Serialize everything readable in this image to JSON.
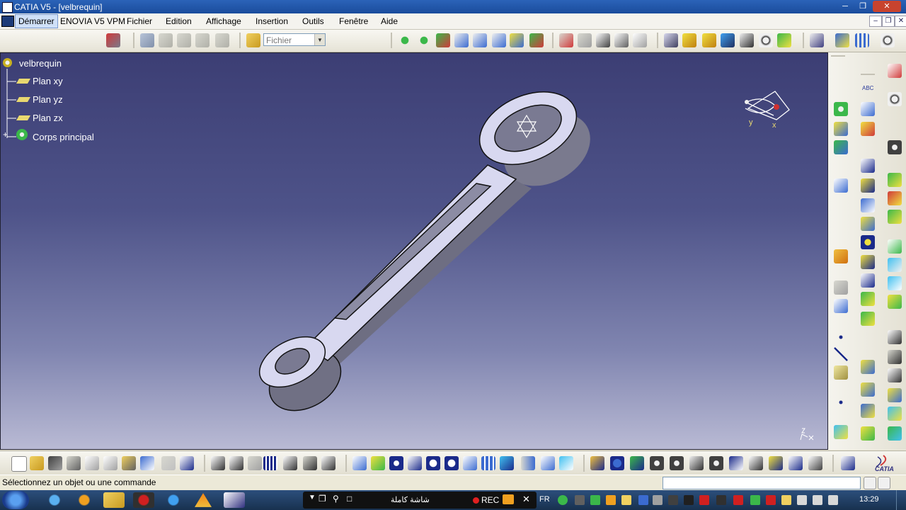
{
  "window": {
    "title": "CATIA V5 - [velbrequin]"
  },
  "menu": {
    "items": [
      "Démarrer",
      "ENOVIA V5 VPM",
      "Fichier",
      "Edition",
      "Affichage",
      "Insertion",
      "Outils",
      "Fenêtre",
      "Aide"
    ]
  },
  "toolbar": {
    "file_select": "Fichier"
  },
  "tree": {
    "root": "velbrequin",
    "nodes": [
      "Plan xy",
      "Plan yz",
      "Plan zx",
      "Corps principal"
    ]
  },
  "compass": {
    "y_label": "y",
    "x_label": "x"
  },
  "right_toolbar": {
    "abc_label": "ABC"
  },
  "status": {
    "message": "Sélectionnez un objet ou une commande"
  },
  "taskbar": {
    "rec_label": "REC",
    "fullscreen_label": "شاشة كاملة",
    "lang": "FR",
    "clock": "13:29"
  },
  "bottom_toolbar": {
    "catia_logo": "CATIA"
  },
  "colors": {
    "viewport_top": "#3c3e74",
    "viewport_bottom": "#b9bad4",
    "part_fill": "#d8d8f0"
  }
}
